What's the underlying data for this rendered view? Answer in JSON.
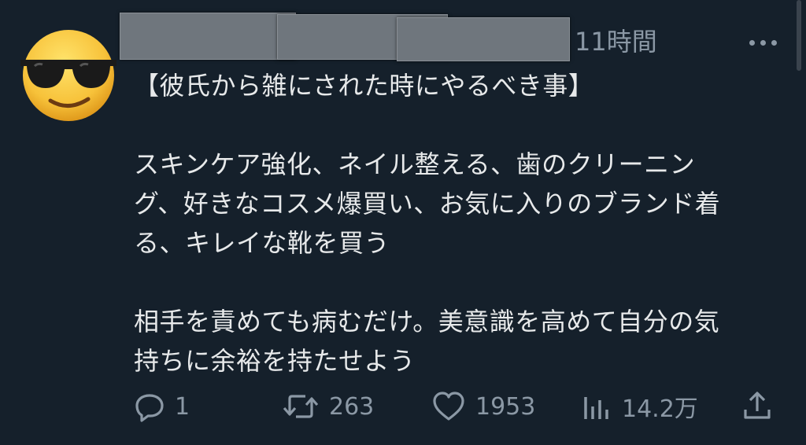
{
  "post": {
    "time": "11時間",
    "lines": [
      "【彼氏から雑にされた時にやるべき事】",
      "",
      "スキンケア強化、ネイル整える、歯のクリーニン",
      "グ、好きなコスメ爆買い、お気に入りのブランド着",
      "る、キレイな靴を買う",
      "",
      "相手を責めても病むだけ。美意識を高めて自分の気",
      "持ちに余裕を持たせよう"
    ],
    "actions": {
      "reply_count": "1",
      "repost_count": "263",
      "like_count": "1953",
      "views_count": "14.2万"
    }
  },
  "icons": {
    "avatar": "sunglasses-emoji-icon",
    "more": "more-dots-icon",
    "reply": "reply-icon",
    "repost": "repost-icon",
    "like": "heart-icon",
    "views": "views-icon",
    "share": "share-icon"
  },
  "colors": {
    "background": "#15202b",
    "text": "#e7e9ea",
    "muted": "#8b98a5"
  }
}
